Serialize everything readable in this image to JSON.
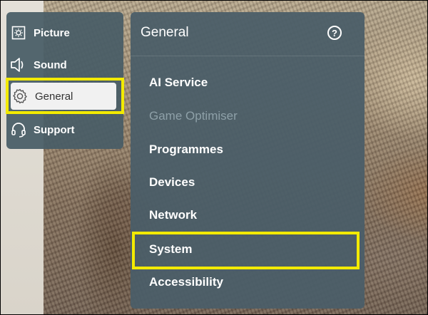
{
  "categories": [
    {
      "label": "Picture",
      "icon": "picture-icon"
    },
    {
      "label": "Sound",
      "icon": "sound-icon"
    },
    {
      "label": "General",
      "icon": "gear-icon",
      "selected": true
    },
    {
      "label": "Support",
      "icon": "headset-icon"
    }
  ],
  "general_panel": {
    "title": "General",
    "help": "?",
    "items": [
      {
        "label": "AI Service",
        "enabled": true
      },
      {
        "label": "Game Optimiser",
        "enabled": false
      },
      {
        "label": "Programmes",
        "enabled": true
      },
      {
        "label": "Devices",
        "enabled": true
      },
      {
        "label": "Network",
        "enabled": true
      },
      {
        "label": "System",
        "enabled": true,
        "highlighted": true
      },
      {
        "label": "Accessibility",
        "enabled": true
      }
    ]
  },
  "colors": {
    "panel": "#4a5e68",
    "highlight": "#f3ea00",
    "selected_bg": "#f1f1f1",
    "disabled_text": "#8ea0a8"
  }
}
